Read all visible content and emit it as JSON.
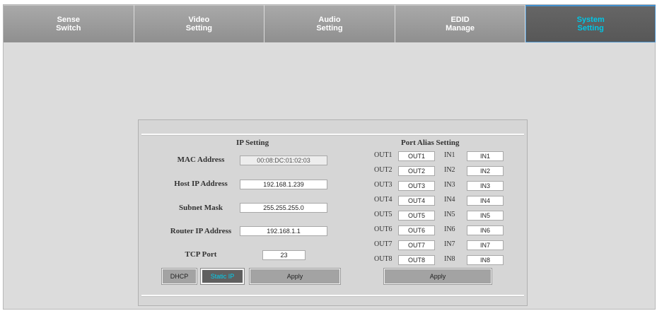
{
  "tabs": [
    {
      "line1": "Sense",
      "line2": "Switch"
    },
    {
      "line1": "Video",
      "line2": "Setting"
    },
    {
      "line1": "Audio",
      "line2": "Setting"
    },
    {
      "line1": "EDID",
      "line2": "Manage"
    },
    {
      "line1": "System",
      "line2": "Setting"
    }
  ],
  "active_tab": "System Setting",
  "ip": {
    "title": "IP Setting",
    "mac_label": "MAC Address",
    "mac_value": "00:08:DC:01:02:03",
    "host_label": "Host IP Address",
    "host_value": "192.168.1.239",
    "subnet_label": "Subnet Mask",
    "subnet_value": "255.255.255.0",
    "router_label": "Router IP Address",
    "router_value": "192.168.1.1",
    "tcp_label": "TCP Port",
    "tcp_value": "23",
    "dhcp_label": "DHCP",
    "static_label": "Static IP",
    "apply_label": "Apply"
  },
  "alias": {
    "title": "Port Alias Setting",
    "outputs": [
      {
        "label": "OUT1",
        "value": "OUT1"
      },
      {
        "label": "OUT2",
        "value": "OUT2"
      },
      {
        "label": "OUT3",
        "value": "OUT3"
      },
      {
        "label": "OUT4",
        "value": "OUT4"
      },
      {
        "label": "OUT5",
        "value": "OUT5"
      },
      {
        "label": "OUT6",
        "value": "OUT6"
      },
      {
        "label": "OUT7",
        "value": "OUT7"
      },
      {
        "label": "OUT8",
        "value": "OUT8"
      }
    ],
    "inputs": [
      {
        "label": "IN1",
        "value": "IN1"
      },
      {
        "label": "IN2",
        "value": "IN2"
      },
      {
        "label": "IN3",
        "value": "IN3"
      },
      {
        "label": "IN4",
        "value": "IN4"
      },
      {
        "label": "IN5",
        "value": "IN5"
      },
      {
        "label": "IN6",
        "value": "IN6"
      },
      {
        "label": "IN7",
        "value": "IN7"
      },
      {
        "label": "IN8",
        "value": "IN8"
      }
    ],
    "apply_label": "Apply"
  },
  "colors": {
    "active_tab_text": "#00c6e6",
    "static_ip_text": "#00d0f0"
  }
}
